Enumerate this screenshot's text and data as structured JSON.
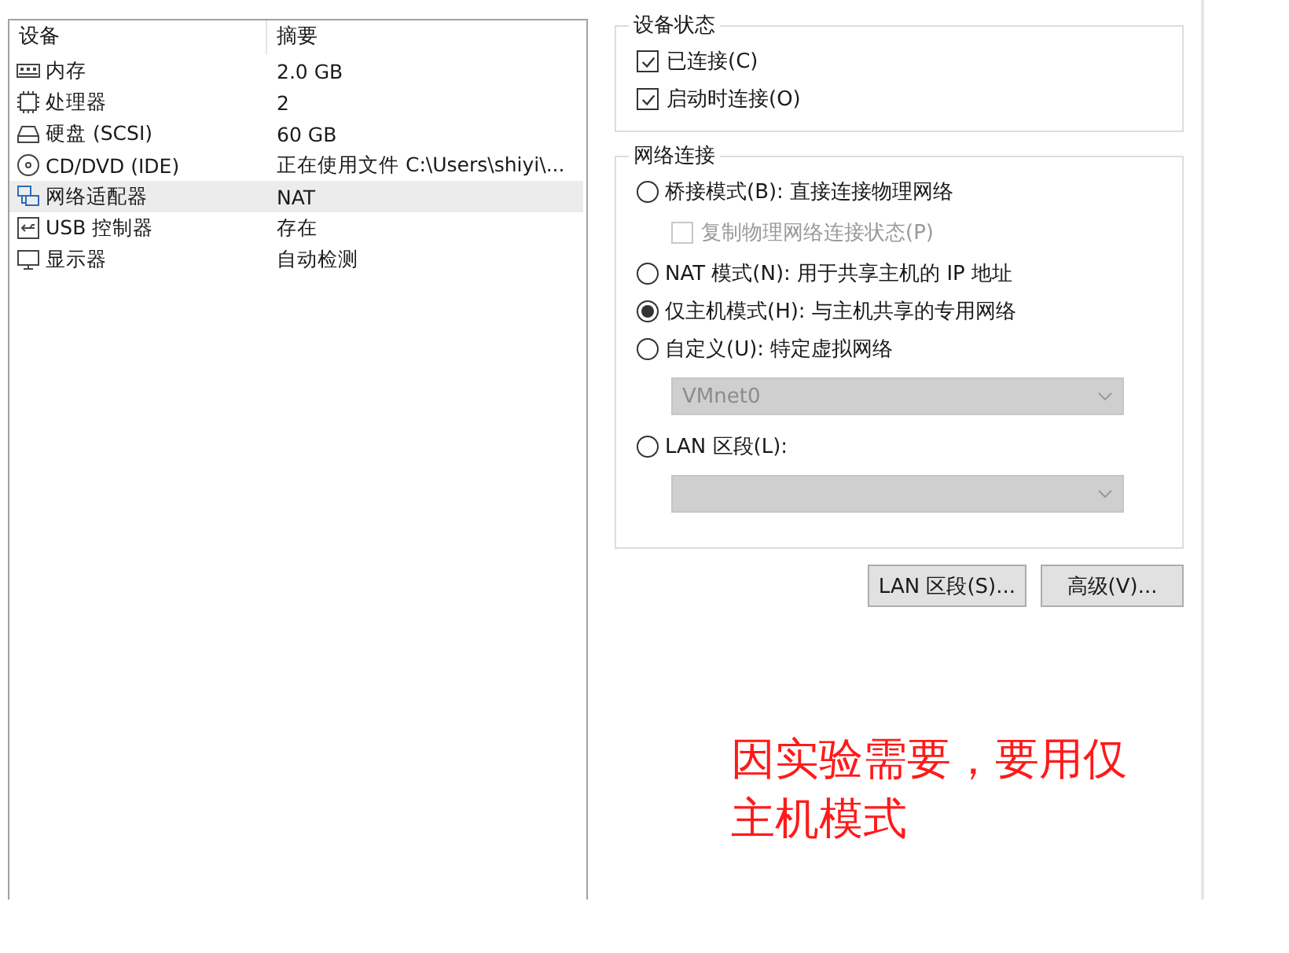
{
  "device_list": {
    "columns": [
      "设备",
      "摘要"
    ],
    "rows": [
      {
        "kind": "memory",
        "device": "内存",
        "summary": "2.0 GB",
        "selected": false
      },
      {
        "kind": "processor",
        "device": "处理器",
        "summary": "2",
        "selected": false
      },
      {
        "kind": "disk",
        "device": "硬盘 (SCSI)",
        "summary": "60 GB",
        "selected": false
      },
      {
        "kind": "cd",
        "device": "CD/DVD (IDE)",
        "summary": "正在使用文件 C:\\Users\\shiyi\\...",
        "selected": false
      },
      {
        "kind": "network",
        "device": "网络适配器",
        "summary": "NAT",
        "selected": true
      },
      {
        "kind": "usb",
        "device": "USB 控制器",
        "summary": "存在",
        "selected": false
      },
      {
        "kind": "display",
        "device": "显示器",
        "summary": "自动检测",
        "selected": false
      }
    ]
  },
  "device_status": {
    "title": "设备状态",
    "options": [
      {
        "label": "已连接(C)",
        "checked": true
      },
      {
        "label": "启动时连接(O)",
        "checked": true
      }
    ]
  },
  "network_connection": {
    "title": "网络连接",
    "options": [
      {
        "label": "桥接模式(B): 直接连接物理网络",
        "selected": false,
        "sub": {
          "kind": "checkbox",
          "label": "复制物理网络连接状态(P)",
          "checked": false,
          "disabled": true
        }
      },
      {
        "label": "NAT 模式(N): 用于共享主机的 IP 地址",
        "selected": false
      },
      {
        "label": "仅主机模式(H): 与主机共享的专用网络",
        "selected": true
      },
      {
        "label": "自定义(U): 特定虚拟网络",
        "selected": false,
        "sub": {
          "kind": "dropdown",
          "value": "VMnet0",
          "disabled": true
        }
      },
      {
        "label": "LAN 区段(L):",
        "selected": false,
        "sub": {
          "kind": "dropdown",
          "disabled": true
        }
      }
    ]
  },
  "buttons": [
    "LAN 区段(S)...",
    "高级(V)..."
  ],
  "annotation": "因实验需要，要用仅主机模式"
}
